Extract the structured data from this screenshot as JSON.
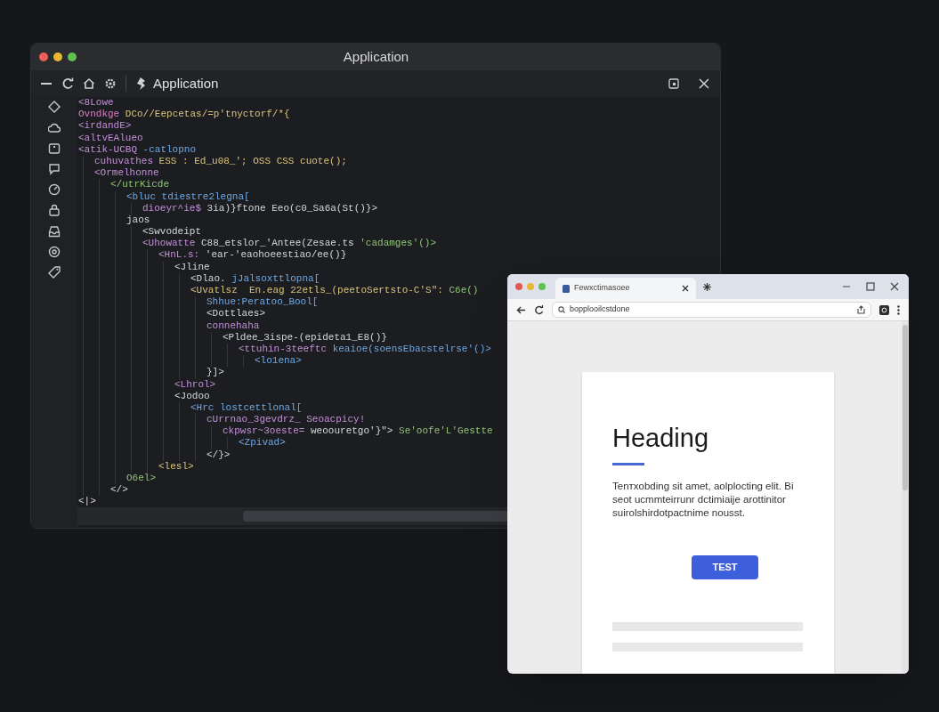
{
  "editor": {
    "title": "Application",
    "toolbar_title": "Application",
    "code": [
      {
        "segments": [
          {
            "text": "<8Lowe",
            "kind": "tag"
          }
        ]
      },
      {
        "segments": [
          {
            "text": "Ovndkge",
            "kind": "keyword"
          },
          {
            "text": " DCo//Eepcetas/=p'tnyctorf/*{",
            "kind": "value"
          }
        ]
      },
      {
        "segments": [
          {
            "text": "<irdandE>",
            "kind": "tag"
          }
        ]
      },
      {
        "segments": [
          {
            "text": "<altvEAlueo",
            "kind": "tag"
          }
        ]
      },
      {
        "segments": [
          {
            "text": "<atik-UCBQ",
            "kind": "tag"
          },
          {
            "text": " -catlopno",
            "kind": "attr"
          }
        ],
        "children": [
          {
            "segments": [
              {
                "text": "cuhuvathes",
                "kind": "tag"
              },
              {
                "text": " ESS : Ed_u08_'; OSS CSS cuote();",
                "kind": "value"
              }
            ]
          },
          {
            "segments": [
              {
                "text": "<Ormelhonne",
                "kind": "tag"
              }
            ],
            "children": [
              {
                "segments": [
                  {
                    "text": "</utrKicde",
                    "kind": "string"
                  }
                ],
                "children": [
                  {
                    "segments": [
                      {
                        "text": "<bluc tdiestre2legna[",
                        "kind": "attr"
                      }
                    ],
                    "children": [
                      {
                        "segments": [
                          {
                            "text": "dioeyr^ie$",
                            "kind": "tag"
                          },
                          {
                            "text": " 3ia)}ftone Eeo(c0_Sa6a(St()}>",
                            "kind": "plain"
                          }
                        ]
                      }
                    ]
                  },
                  {
                    "segments": [
                      {
                        "text": "jaos",
                        "kind": "plain"
                      }
                    ],
                    "children": [
                      {
                        "segments": [
                          {
                            "text": "<Swvodeipt",
                            "kind": "plain"
                          }
                        ]
                      },
                      {
                        "segments": [
                          {
                            "text": "<Uhowatte",
                            "kind": "tag"
                          },
                          {
                            "text": " C88_etslor_'Antee(Zesae.ts",
                            "kind": "plain"
                          },
                          {
                            "text": " 'cadamges'()>",
                            "kind": "string"
                          }
                        ],
                        "children": [
                          {
                            "segments": [
                              {
                                "text": "<HnL.s:",
                                "kind": "tag"
                              },
                              {
                                "text": " 'ear-'eaohoeestiao/ee()}",
                                "kind": "plain"
                              }
                            ],
                            "children": [
                              {
                                "segments": [
                                  {
                                    "text": "<Jline",
                                    "kind": "plain"
                                  }
                                ],
                                "children": [
                                  {
                                    "segments": [
                                      {
                                        "text": "<Dlao.",
                                        "kind": "plain"
                                      },
                                      {
                                        "text": " jJalsoxttlopna[",
                                        "kind": "attr"
                                      }
                                    ]
                                  },
                                  {
                                    "segments": [
                                      {
                                        "text": "<Uvatlsz  En.eag 22etls_(peetoSertsto-C'S\":",
                                        "kind": "value"
                                      },
                                      {
                                        "text": " C6e()",
                                        "kind": "string"
                                      }
                                    ],
                                    "children": [
                                      {
                                        "segments": [
                                          {
                                            "text": "Shhue:Peratoo_Bool[",
                                            "kind": "attr"
                                          }
                                        ]
                                      },
                                      {
                                        "segments": [
                                          {
                                            "text": "<Dottlaes>",
                                            "kind": "plain"
                                          }
                                        ]
                                      },
                                      {
                                        "segments": [
                                          {
                                            "text": "connehaha",
                                            "kind": "tag"
                                          }
                                        ],
                                        "children": [
                                          {
                                            "segments": [
                                              {
                                                "text": "<Pldee_3ispe-(epideta1_E8()}",
                                                "kind": "plain"
                                              }
                                            ],
                                            "children": [
                                              {
                                                "segments": [
                                                  {
                                                    "text": "<ttuhin-3teeftc",
                                                    "kind": "tag"
                                                  },
                                                  {
                                                    "text": " keaioe(soensEbacstelrse'()>",
                                                    "kind": "attr"
                                                  }
                                                ],
                                                "children": [
                                                  {
                                                    "segments": [
                                                      {
                                                        "text": "<lo1ena>",
                                                        "kind": "attr"
                                                      }
                                                    ]
                                                  }
                                                ]
                                              }
                                            ]
                                          }
                                        ]
                                      },
                                      {
                                        "segments": [
                                          {
                                            "text": "}]>",
                                            "kind": "plain"
                                          }
                                        ]
                                      }
                                    ]
                                  }
                                ]
                              },
                              {
                                "segments": [
                                  {
                                    "text": "<Lhrol>",
                                    "kind": "tag"
                                  }
                                ]
                              },
                              {
                                "segments": [
                                  {
                                    "text": "<Jodoo",
                                    "kind": "plain"
                                  }
                                ],
                                "children": [
                                  {
                                    "segments": [
                                      {
                                        "text": "<Hrc lostcettlonal[",
                                        "kind": "attr"
                                      }
                                    ],
                                    "children": [
                                      {
                                        "segments": [
                                          {
                                            "text": "cUrrnao_3gevdrz_ Seoacpicy!",
                                            "kind": "tag"
                                          }
                                        ],
                                        "children": [
                                          {
                                            "segments": [
                                              {
                                                "text": "ckpwsr~3oeste=",
                                                "kind": "tag"
                                              },
                                              {
                                                "text": " weoouretgo'}\">",
                                                "kind": "plain"
                                              },
                                              {
                                                "text": " Se'oofe'L'Gestte",
                                                "kind": "string"
                                              }
                                            ],
                                            "children": [
                                              {
                                                "segments": [
                                                  {
                                                    "text": "<Zpivad>",
                                                    "kind": "attr"
                                                  }
                                                ]
                                              }
                                            ]
                                          }
                                        ]
                                      },
                                      {
                                        "segments": [
                                          {
                                            "text": "</}>",
                                            "kind": "plain"
                                          }
                                        ]
                                      }
                                    ]
                                  }
                                ]
                              }
                            ]
                          },
                          {
                            "segments": [
                              {
                                "text": "<lesl>",
                                "kind": "value"
                              }
                            ]
                          }
                        ]
                      }
                    ]
                  },
                  {
                    "segments": [
                      {
                        "text": "O6el>",
                        "kind": "string"
                      }
                    ]
                  }
                ]
              },
              {
                "segments": [
                  {
                    "text": "</>",
                    "kind": "plain"
                  }
                ]
              }
            ]
          }
        ]
      },
      {
        "segments": [
          {
            "text": "<|>",
            "kind": "plain"
          }
        ]
      }
    ]
  },
  "browser": {
    "tab_title": "Fewxctimasoee",
    "url": "bopplooilcstdone",
    "page": {
      "heading": "Heading",
      "paragraph": "Tenтxobding sit amet, aolplocting elit. Bi seot ucmmteirrunr dctimiaije arottinitor suirolshirdotpactnime nousst.",
      "button": "TEST"
    }
  }
}
